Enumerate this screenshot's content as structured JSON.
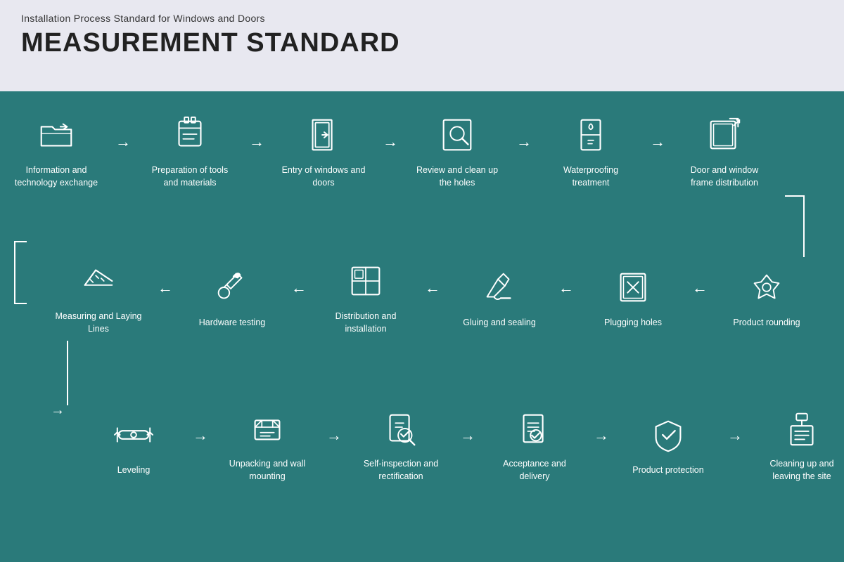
{
  "header": {
    "subtitle": "Installation Process Standard for Windows and Doors",
    "title": "MEASUREMENT STANDARD"
  },
  "rows": [
    {
      "id": "row1",
      "steps": [
        {
          "id": "info-exchange",
          "label": "Information and technology exchange",
          "icon": "folder"
        },
        {
          "id": "tools-prep",
          "label": "Preparation of tools and materials",
          "icon": "tools"
        },
        {
          "id": "entry-windows",
          "label": "Entry of windows and doors",
          "icon": "door-enter"
        },
        {
          "id": "review-holes",
          "label": "Review and clean up the holes",
          "icon": "search-hole"
        },
        {
          "id": "waterproofing",
          "label": "Waterproofing treatment",
          "icon": "waterproof"
        },
        {
          "id": "frame-dist",
          "label": "Door and window frame distribution",
          "icon": "frame-export"
        }
      ]
    },
    {
      "id": "row2",
      "steps": [
        {
          "id": "measuring",
          "label": "Measuring and Laying Lines",
          "icon": "measure"
        },
        {
          "id": "hardware",
          "label": "Hardware testing",
          "icon": "hardware"
        },
        {
          "id": "distribution",
          "label": "Distribution and installation",
          "icon": "distribution"
        },
        {
          "id": "gluing",
          "label": "Gluing and sealing",
          "icon": "gluing"
        },
        {
          "id": "plugging",
          "label": "Plugging holes",
          "icon": "plugging"
        },
        {
          "id": "rounding",
          "label": "Product rounding",
          "icon": "rounding"
        }
      ]
    },
    {
      "id": "row3",
      "steps": [
        {
          "id": "leveling",
          "label": "Leveling",
          "icon": "leveling"
        },
        {
          "id": "unpacking",
          "label": "Unpacking and wall mounting",
          "icon": "unpacking"
        },
        {
          "id": "self-inspect",
          "label": "Self-inspection and rectification",
          "icon": "inspect"
        },
        {
          "id": "acceptance",
          "label": "Acceptance and delivery",
          "icon": "acceptance"
        },
        {
          "id": "protection",
          "label": "Product protection",
          "icon": "protection"
        },
        {
          "id": "cleanup",
          "label": "Cleaning up and leaving the site",
          "icon": "cleanup"
        }
      ]
    }
  ]
}
